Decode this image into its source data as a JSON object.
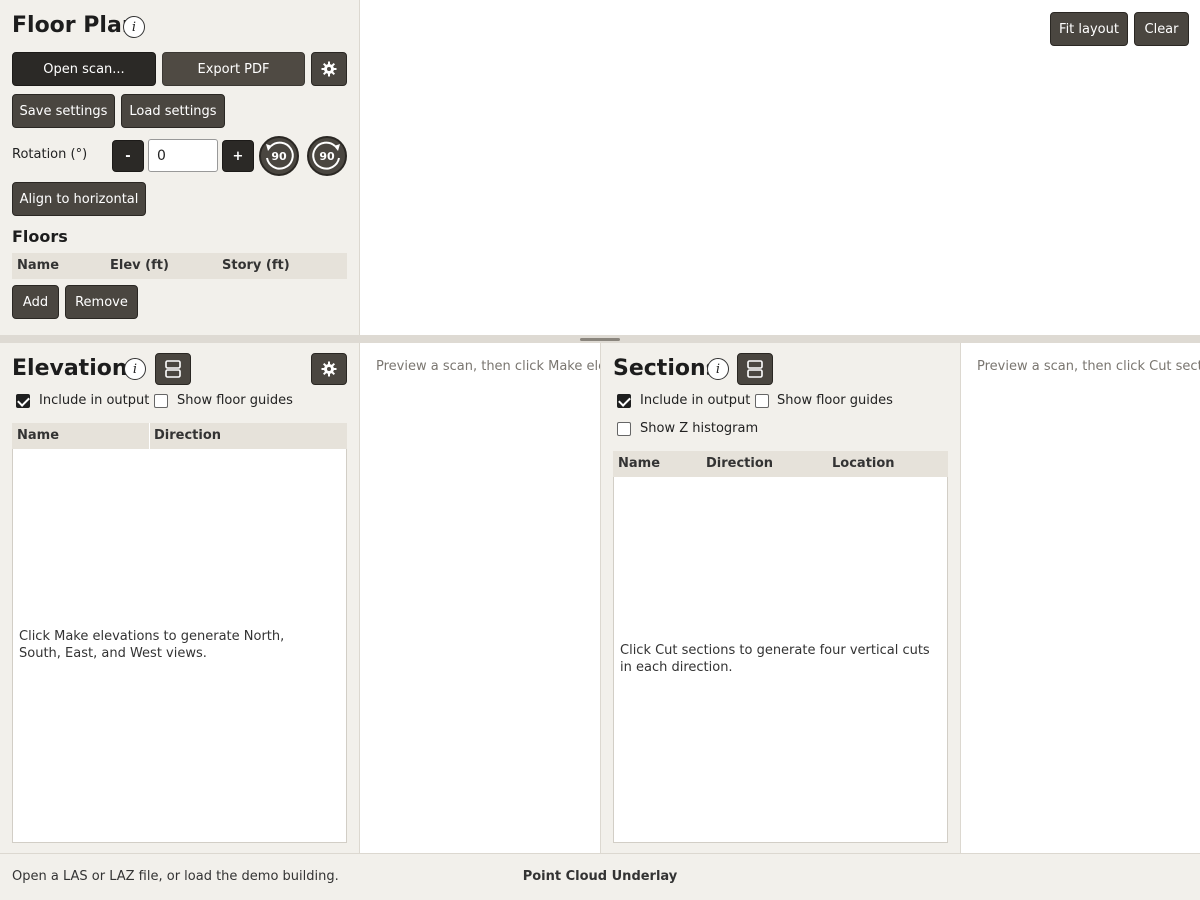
{
  "floorplan": {
    "title": "Floor Plan",
    "open_scan": "Open scan...",
    "export_pdf": "Export PDF",
    "save_settings": "Save settings",
    "load_settings": "Load settings",
    "rotation_label": "Rotation (°)",
    "minus": "-",
    "plus": "+",
    "rotation_value": "0",
    "rotate_ccw": "90",
    "rotate_cw": "90",
    "align": "Align to horizontal",
    "floors_title": "Floors",
    "columns": [
      "Name",
      "Elev (ft)",
      "Story (ft)"
    ],
    "add": "Add",
    "remove": "Remove"
  },
  "canvas": {
    "fit_layout": "Fit layout",
    "clear": "Clear"
  },
  "elevations": {
    "title": "Elevations",
    "include_output": "Include in output",
    "include_checked": true,
    "show_floor_guides": "Show floor guides",
    "floor_guides_checked": false,
    "columns": [
      "Name",
      "Direction"
    ],
    "empty_message": "Click Make elevations to generate North, South, East, and West views.",
    "preview_hint": "Preview a scan, then click Make elevations"
  },
  "sections": {
    "title": "Sections",
    "include_output": "Include in output",
    "include_checked": true,
    "show_floor_guides": "Show floor guides",
    "floor_guides_checked": false,
    "show_z_histogram": "Show Z histogram",
    "z_histogram_checked": false,
    "columns": [
      "Name",
      "Direction",
      "Location"
    ],
    "empty_message": "Click Cut sections to generate four vertical cuts in each direction.",
    "preview_hint": "Preview a scan, then click Cut sections"
  },
  "status": {
    "message": "Open a LAS or LAZ file, or load the demo building.",
    "center": "Point Cloud Underlay"
  }
}
